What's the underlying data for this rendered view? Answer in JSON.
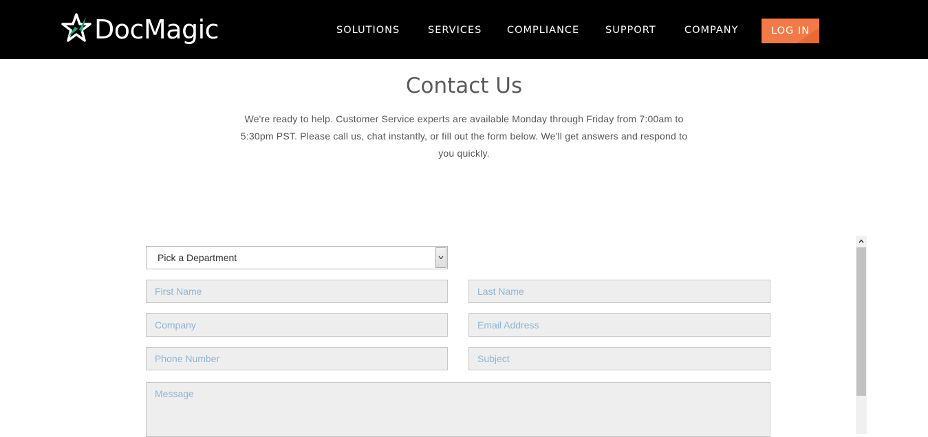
{
  "header": {
    "logo_text": "DocMagic",
    "nav": [
      {
        "label": "SOLUTIONS"
      },
      {
        "label": "SERVICES"
      },
      {
        "label": "COMPLIANCE"
      },
      {
        "label": "SUPPORT"
      },
      {
        "label": "COMPANY"
      }
    ],
    "login_label": "LOG IN",
    "colors": {
      "background": "#000000",
      "accent": "#f27a48",
      "logo_star": "#1fa77a"
    }
  },
  "main": {
    "title": "Contact Us",
    "intro_lines": [
      "We're ready to help. Customer Service experts are available Monday through Friday from 7:00am to",
      "5:30pm PST. Please call us, chat instantly, or fill out the form below. We'll get answers and respond to",
      "you quickly."
    ]
  },
  "form": {
    "department_select": {
      "value": "Pick a Department"
    },
    "fields": {
      "first_name": {
        "placeholder": "First Name"
      },
      "last_name": {
        "placeholder": "Last Name"
      },
      "company": {
        "placeholder": "Company"
      },
      "email": {
        "placeholder": "Email Address"
      },
      "phone": {
        "placeholder": "Phone Number"
      },
      "subject": {
        "placeholder": "Subject"
      },
      "message": {
        "placeholder": "Message"
      }
    }
  }
}
